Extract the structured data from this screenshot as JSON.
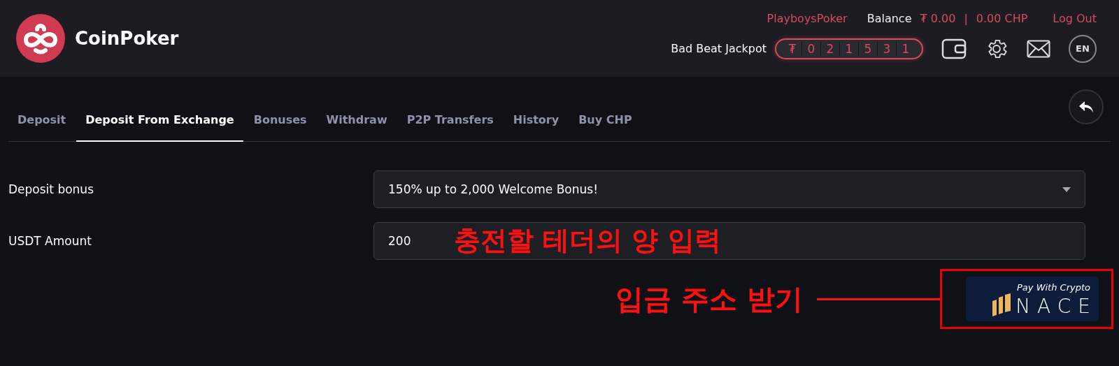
{
  "header": {
    "logo": "CoinPoker",
    "username": "PlayboysPoker",
    "balance_label": "Balance",
    "balance_usdt": "₮ 0.00",
    "separator": "|",
    "balance_chp": "0.00 CHP",
    "logout": "Log Out",
    "jackpot_label": "Bad Beat Jackpot",
    "jackpot_digits": [
      "₮",
      "0",
      "2",
      "1",
      "5",
      "3",
      "1"
    ],
    "language": "EN"
  },
  "tabs": [
    {
      "label": "Deposit",
      "selected": false
    },
    {
      "label": "Deposit From Exchange",
      "selected": true
    },
    {
      "label": "Bonuses",
      "selected": false
    },
    {
      "label": "Withdraw",
      "selected": false
    },
    {
      "label": "P2P Transfers",
      "selected": false
    },
    {
      "label": "History",
      "selected": false
    },
    {
      "label": "Buy CHP",
      "selected": false
    }
  ],
  "form": [
    {
      "kind": "select",
      "label": "Deposit bonus",
      "value": "150% up to 2,000 Welcome Bonus!"
    },
    {
      "kind": "input",
      "label": "USDT Amount",
      "value": "200"
    }
  ],
  "annotations": {
    "amount_note": "충전할 테더의 양 입력",
    "address_note": "입금 주소 받기"
  },
  "pay_button": {
    "caption": "Pay With Crypto",
    "brand": "NACE"
  }
}
